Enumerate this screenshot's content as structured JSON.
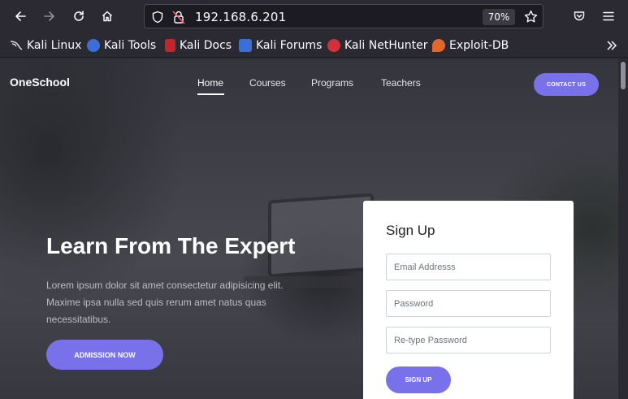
{
  "browser": {
    "url": "192.168.6.201",
    "zoom": "70%",
    "bookmarks": [
      {
        "label": "Kali Linux",
        "icon": "kali-dragon-icon",
        "color": "#222222"
      },
      {
        "label": "Kali Tools",
        "icon": "kali-tools-icon",
        "color": "#3b6fd6"
      },
      {
        "label": "Kali Docs",
        "icon": "kali-docs-icon",
        "color": "#c0262d"
      },
      {
        "label": "Kali Forums",
        "icon": "kali-forums-icon",
        "color": "#3b6fd6"
      },
      {
        "label": "Kali NetHunter",
        "icon": "kali-nethunter-icon",
        "color": "#d1323a"
      },
      {
        "label": "Exploit-DB",
        "icon": "exploit-db-icon",
        "color": "#e2672b"
      }
    ]
  },
  "site": {
    "brand": "OneSchool",
    "nav": [
      {
        "label": "Home",
        "active": true
      },
      {
        "label": "Courses",
        "active": false
      },
      {
        "label": "Programs",
        "active": false
      },
      {
        "label": "Teachers",
        "active": false
      }
    ],
    "contact_label": "CONTACT US",
    "accent": "#7971ea"
  },
  "hero": {
    "title": "Learn From The Expert",
    "text": "Lorem ipsum dolor sit amet consectetur adipisicing elit. Maxime ipsa nulla sed quis rerum amet natus quas necessitatibus.",
    "button": "ADMISSION NOW"
  },
  "signup": {
    "title": "Sign Up",
    "email_placeholder": "Email Addresss",
    "password_placeholder": "Password",
    "retype_placeholder": "Re-type Password",
    "button": "SIGN UP"
  }
}
